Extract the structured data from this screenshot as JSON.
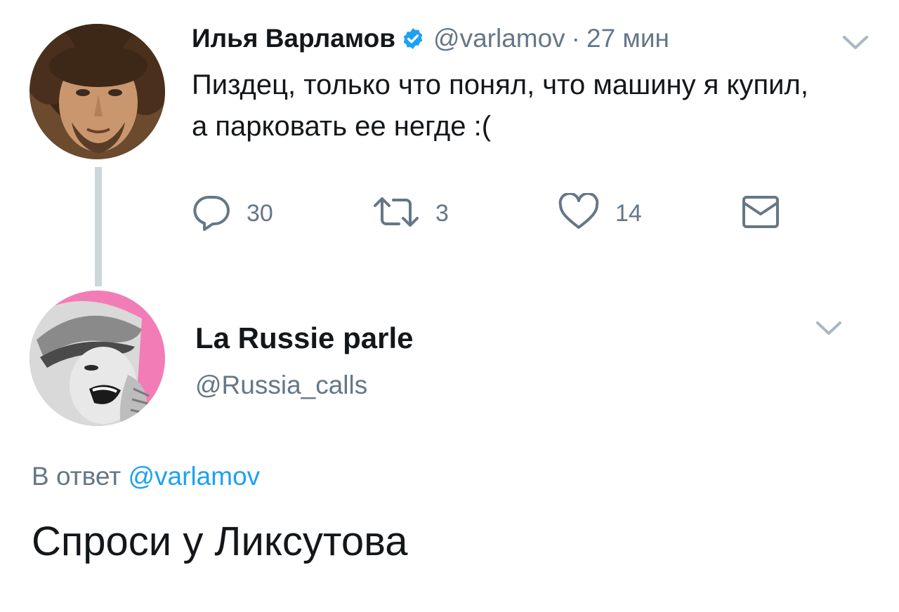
{
  "tweet": {
    "author": {
      "display_name": "Илья Варламов",
      "handle": "@varlamov",
      "verified": true
    },
    "time_separator": "·",
    "time": "27 мин",
    "text": "Пиздец, только что понял, что машину я купил, а парковать ее негде :(",
    "actions": {
      "replies": {
        "icon": "reply-icon",
        "count": "30"
      },
      "retweets": {
        "icon": "retweet-icon",
        "count": "3"
      },
      "likes": {
        "icon": "heart-icon",
        "count": "14"
      },
      "dm": {
        "icon": "envelope-icon"
      }
    },
    "menu_icon": "chevron-down-icon"
  },
  "reply": {
    "author": {
      "display_name": "La Russie parle",
      "handle": "@Russia_calls"
    },
    "menu_icon": "chevron-down-icon",
    "reply_to_prefix": "В ответ",
    "reply_to_handle": "@varlamov",
    "text": "Спроси у Ликсутова"
  },
  "colors": {
    "primary_text": "#14171a",
    "secondary_text": "#657786",
    "accent": "#1da1f2",
    "thread_line": "#ccd6dd",
    "verified_badge": "#1da1f2",
    "avatar2_background": "#f27db6"
  }
}
